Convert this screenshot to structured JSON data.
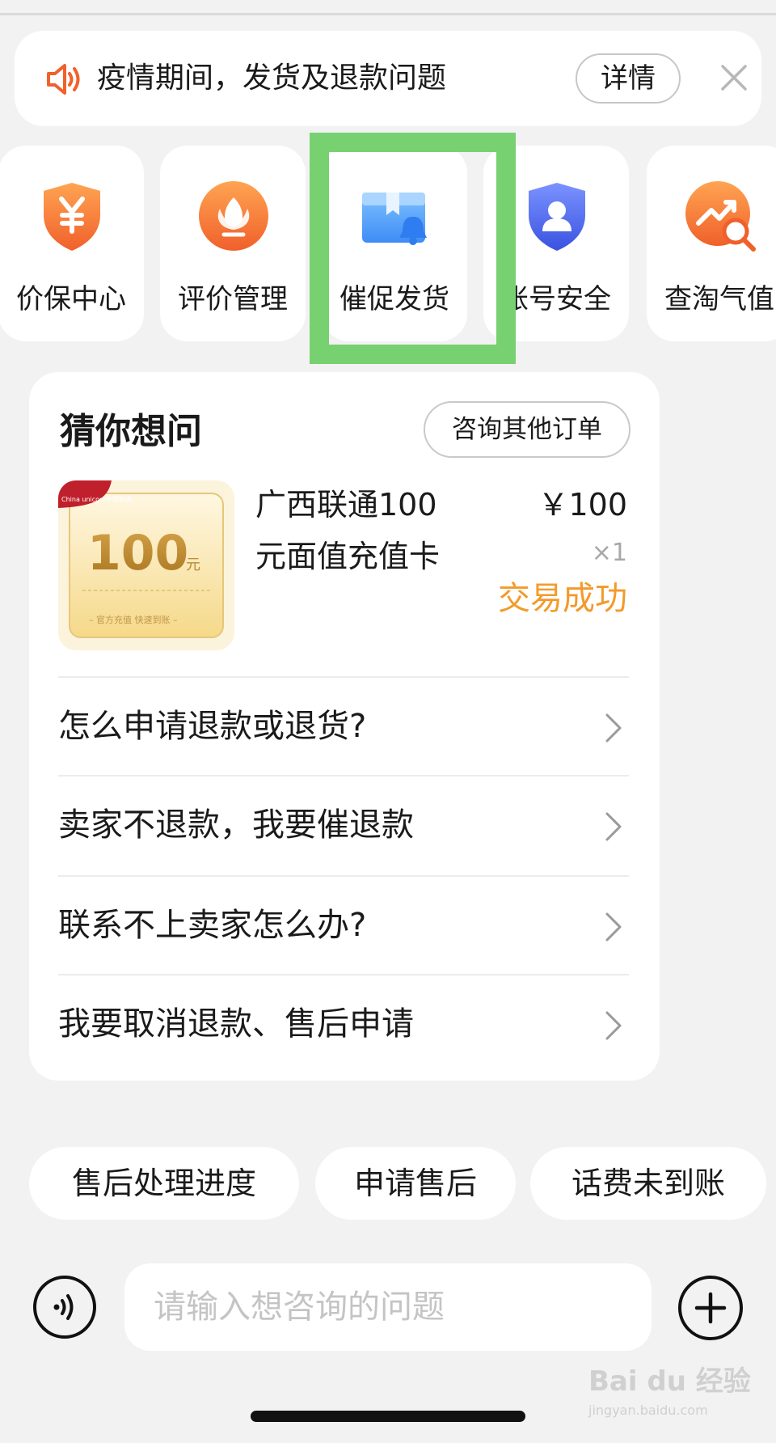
{
  "notice": {
    "text": "疫情期间，发货及退款问题",
    "detail_label": "详情"
  },
  "services": [
    {
      "label": "价保中心",
      "icon": "yen-shield-icon"
    },
    {
      "label": "评价管理",
      "icon": "flower-icon"
    },
    {
      "label": "催促发货",
      "icon": "package-bell-icon",
      "highlighted": true
    },
    {
      "label": "账号安全",
      "icon": "user-shield-icon"
    },
    {
      "label": "查淘气值",
      "icon": "trend-search-icon"
    }
  ],
  "guess": {
    "title": "猜你想问",
    "other_orders_label": "咨询其他订单",
    "product": {
      "name": "广西联通100元面值充值卡",
      "price": "￥100",
      "quantity": "×1",
      "status": "交易成功",
      "thumb_brand": "China unicom中国联通",
      "thumb_value": "100",
      "thumb_unit": "元",
      "thumb_caption": "– 官方充值   快速到账 –"
    },
    "questions": [
      "怎么申请退款或退货?",
      "卖家不退款，我要催退款",
      "联系不上卖家怎么办?",
      "我要取消退款、售后申请"
    ]
  },
  "quick_chips": [
    "售后处理进度",
    "申请售后",
    "话费未到账"
  ],
  "input": {
    "placeholder": "请输入想咨询的问题"
  },
  "watermark": {
    "brand": "Bai du 经验",
    "url": "jingyan.baidu.com"
  },
  "colors": {
    "accent_orange": "#f39a2a",
    "highlight_green": "#77d170",
    "background": "#f2f2f2"
  }
}
